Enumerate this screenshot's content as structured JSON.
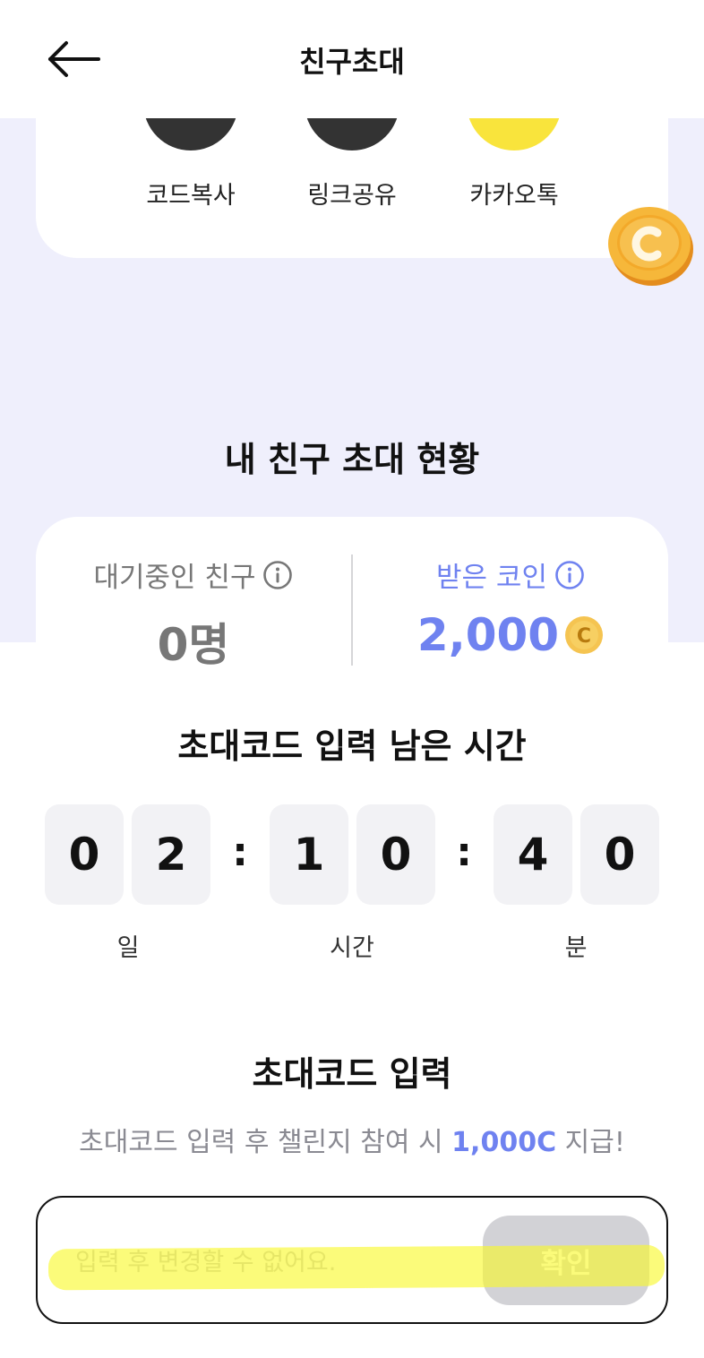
{
  "header": {
    "title": "친구초대"
  },
  "share": {
    "items": [
      {
        "label": "코드복사",
        "color": "#333333"
      },
      {
        "label": "링크공유",
        "color": "#333333"
      },
      {
        "label": "카카오톡",
        "color": "#f9e43c"
      }
    ]
  },
  "status": {
    "title": "내 친구 초대 현황",
    "pending_label": "대기중인 친구",
    "pending_value": "0명",
    "coins_label": "받은 코인",
    "coins_value": "2,000",
    "coin_symbol": "C"
  },
  "timer": {
    "title": "초대코드 입력 남은 시간",
    "digits": [
      "0",
      "2",
      "1",
      "0",
      "4",
      "0"
    ],
    "separator": ":",
    "units": [
      "일",
      "시간",
      "분"
    ]
  },
  "code": {
    "title": "초대코드 입력",
    "subtitle_prefix": "초대코드 입력 후 챌린지 참여 시 ",
    "subtitle_accent": "1,000C",
    "subtitle_suffix": " 지급!",
    "placeholder": "입력 후 변경할 수 없어요.",
    "confirm_label": "확인"
  },
  "colors": {
    "accent": "#6f82f0",
    "lavender_bg": "#efeffc",
    "coin_gold": "#f5b431"
  }
}
